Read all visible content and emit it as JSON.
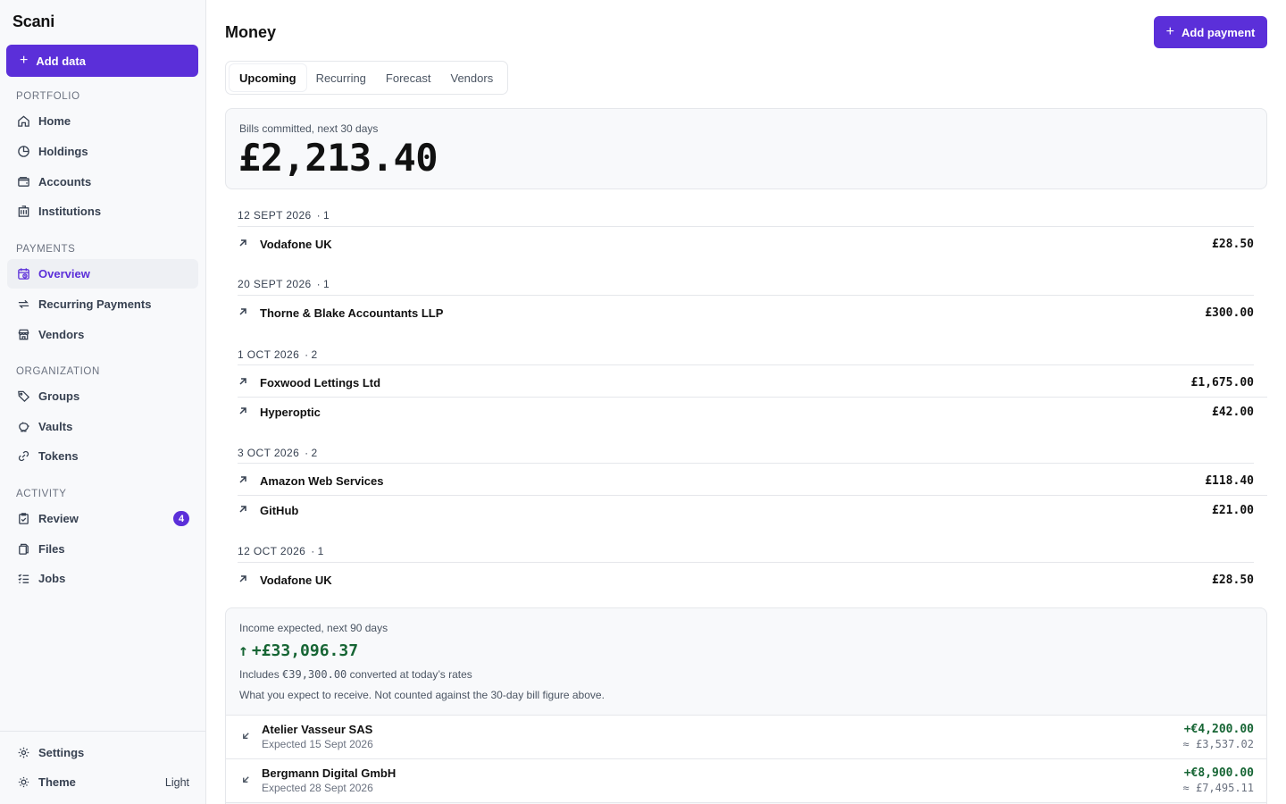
{
  "app": {
    "name": "Scani"
  },
  "sidebar": {
    "add_data": "Add data",
    "sections": {
      "portfolio": "PORTFOLIO",
      "payments": "PAYMENTS",
      "organization": "ORGANIZATION",
      "activity": "ACTIVITY"
    },
    "items": {
      "home": "Home",
      "holdings": "Holdings",
      "accounts": "Accounts",
      "institutions": "Institutions",
      "overview": "Overview",
      "recurring": "Recurring Payments",
      "vendors": "Vendors",
      "groups": "Groups",
      "vaults": "Vaults",
      "tokens": "Tokens",
      "review": "Review",
      "review_badge": "4",
      "files": "Files",
      "jobs": "Jobs"
    },
    "settings": "Settings",
    "theme": "Theme",
    "theme_value": "Light"
  },
  "header": {
    "title": "Money",
    "add_payment": "Add payment"
  },
  "tabs": [
    "Upcoming",
    "Recurring",
    "Forecast",
    "Vendors"
  ],
  "bills": {
    "label": "Bills committed, next 30 days",
    "total": "£2,213.40",
    "groups": [
      {
        "date": "12 SEPT 2026",
        "count": "· 1",
        "items": [
          {
            "name": "Vodafone UK",
            "amount": "£28.50"
          }
        ]
      },
      {
        "date": "20 SEPT 2026",
        "count": "· 1",
        "items": [
          {
            "name": "Thorne & Blake Accountants LLP",
            "amount": "£300.00"
          }
        ]
      },
      {
        "date": "1 OCT 2026",
        "count": "· 2",
        "items": [
          {
            "name": "Foxwood Lettings Ltd",
            "amount": "£1,675.00"
          },
          {
            "name": "Hyperoptic",
            "amount": "£42.00"
          }
        ]
      },
      {
        "date": "3 OCT 2026",
        "count": "· 2",
        "items": [
          {
            "name": "Amazon Web Services",
            "amount": "£118.40"
          },
          {
            "name": "GitHub",
            "amount": "£21.00"
          }
        ]
      },
      {
        "date": "12 OCT 2026",
        "count": "· 1",
        "items": [
          {
            "name": "Vodafone UK",
            "amount": "£28.50"
          }
        ]
      }
    ]
  },
  "income": {
    "label": "Income expected, next 90 days",
    "total": "+£33,096.37",
    "includes_prefix": "Includes ",
    "includes_amount": "€39,300.00",
    "includes_suffix": " converted at today’s rates",
    "note": "What you expect to receive. Not counted against the 30-day bill figure above.",
    "items": [
      {
        "name": "Atelier Vasseur SAS",
        "expected": "Expected 15 Sept 2026",
        "amount": "+€4,200.00",
        "converted": "≈ £3,537.02"
      },
      {
        "name": "Bergmann Digital GmbH",
        "expected": "Expected 28 Sept 2026",
        "amount": "+€8,900.00",
        "converted": "≈ £7,495.11"
      }
    ]
  },
  "colors": {
    "accent": "#5b2fd9",
    "positive": "#166534"
  }
}
